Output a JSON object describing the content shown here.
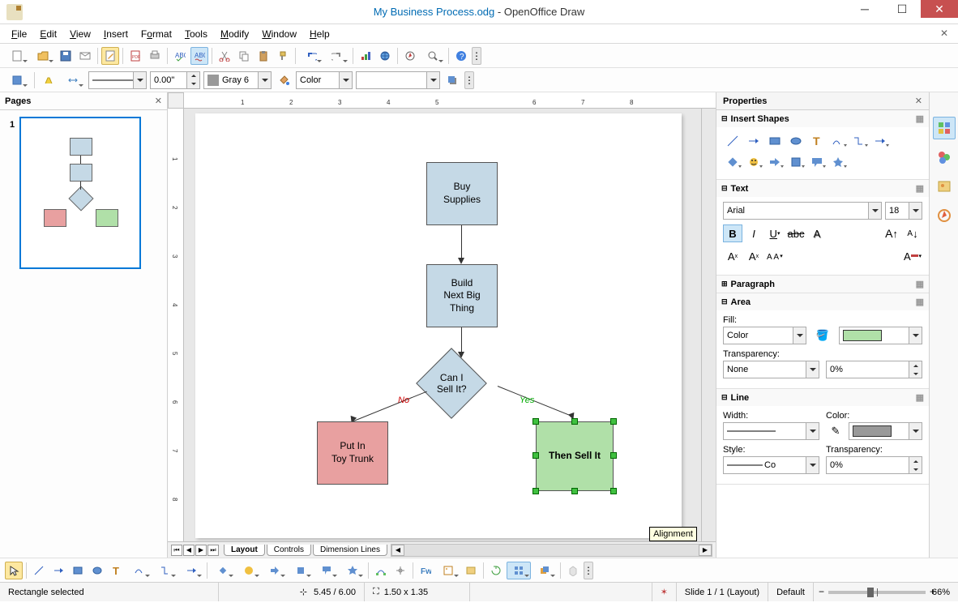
{
  "title": {
    "doc": "My Business Process.odg",
    "app": "OpenOffice Draw"
  },
  "menus": [
    "File",
    "Edit",
    "View",
    "Insert",
    "Format",
    "Tools",
    "Modify",
    "Window",
    "Help"
  ],
  "toolbar2": {
    "line_width": "0.00\"",
    "line_color_name": "Gray 6",
    "fill_type": "Color"
  },
  "pages_panel": {
    "title": "Pages",
    "page_num": "1"
  },
  "flow": {
    "box1": "Buy\nSupplies",
    "box2": "Build\nNext Big\nThing",
    "diamond": "Can I\nSell It?",
    "no": "No",
    "yes": "Yes",
    "box_red": "Put In\nToy Trunk",
    "box_green": "Then Sell It"
  },
  "tabs": {
    "layout": "Layout",
    "controls": "Controls",
    "dims": "Dimension Lines",
    "tooltip": "Alignment"
  },
  "props": {
    "title": "Properties",
    "sec_shapes": "Insert Shapes",
    "sec_text": "Text",
    "font_name": "Arial",
    "font_size": "18",
    "sec_para": "Paragraph",
    "sec_area": "Area",
    "fill_label": "Fill:",
    "fill_type": "Color",
    "transparency_label": "Transparency:",
    "transparency_type": "None",
    "transparency_val": "0%",
    "sec_line": "Line",
    "width_label": "Width:",
    "color_label": "Color:",
    "style_label": "Style:",
    "style_val": "Co",
    "line_transp_val": "0%"
  },
  "status": {
    "sel": "Rectangle selected",
    "pos": "5.45 / 6.00",
    "size": "1.50 x 1.35",
    "slide": "Slide 1 / 1 (Layout)",
    "style": "Default",
    "zoom": "66%"
  }
}
